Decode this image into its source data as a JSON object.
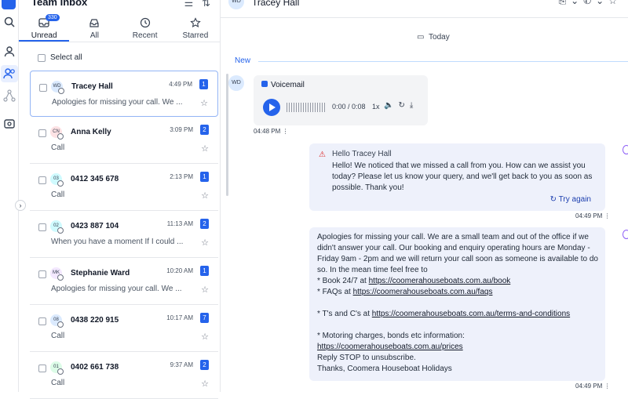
{
  "sidebar": {
    "logo": "app-logo",
    "icons": [
      "search-icon",
      "user-icon",
      "team-icon",
      "flow-icon",
      "settings-icon"
    ]
  },
  "inbox": {
    "title": "Team Inbox",
    "tabs": [
      {
        "label": "Unread",
        "badge": "330"
      },
      {
        "label": "All"
      },
      {
        "label": "Recent"
      },
      {
        "label": "Starred"
      }
    ],
    "select_all": "Select all",
    "items": [
      {
        "initials": "WD",
        "name": "Tracey Hall",
        "time": "4:49 PM",
        "count": "1",
        "preview": "Apologies for missing your call. We ...",
        "avatar_color": "#dbeafe"
      },
      {
        "initials": "CN",
        "name": "Anna Kelly",
        "time": "3:09 PM",
        "count": "2",
        "preview": "Call",
        "avatar_color": "#fde2e4"
      },
      {
        "initials": "03",
        "name": "0412 345 678",
        "time": "2:13 PM",
        "count": "1",
        "preview": "Call",
        "avatar_color": "#cffafe"
      },
      {
        "initials": "02",
        "name": "0423 887 104",
        "time": "11:13 AM",
        "count": "2",
        "preview": "When you have a moment If I could ...",
        "avatar_color": "#cffafe"
      },
      {
        "initials": "MK",
        "name": "Stephanie Ward",
        "time": "10:20 AM",
        "count": "1",
        "preview": "Apologies for missing your call. We ...",
        "avatar_color": "#f3e8ff"
      },
      {
        "initials": "08",
        "name": "0438 220 915",
        "time": "10:17 AM",
        "count": "7",
        "preview": "Call",
        "avatar_color": "#dbeafe"
      },
      {
        "initials": "01",
        "name": "0402 661 738",
        "time": "9:37 AM",
        "count": "2",
        "preview": "Call",
        "avatar_color": "#dcfce7"
      }
    ]
  },
  "conversation": {
    "contact_initials": "WD",
    "contact_name": "Tracey Hall",
    "date_label": "Today",
    "new_label": "New",
    "voicemail": {
      "label": "Voicemail",
      "time": "0:00 / 0:08",
      "speed": "1x",
      "sent": "04:48 PM"
    },
    "auto_reply": {
      "greeting": "Hello Tracey Hall",
      "body": "Hello! We noticed that we missed a call from you. How can we assist you today? Please let us know your query, and we'll get back to you as soon as possible. Thank you!",
      "retry": "Try again",
      "sent": "04:49 PM"
    },
    "sms": {
      "intro": "Apologies for missing your call. We are a small team and out of the office if we didn't answer your call. Our booking and enquiry operating hours are Monday - Friday 9am - 2pm and we will return your call soon as someone is available to do so. In the mean time feel free to",
      "book_prefix": "* Book 24/7 at ",
      "book_link": "https://coomerahouseboats.com.au/book",
      "faq_prefix": "* FAQs at ",
      "faq_link": "https://coomerahouseboats.com.au/faqs",
      "tc_prefix": "* T's and C's at ",
      "tc_link": "https://coomerahouseboats.com.au/terms-and-conditions",
      "motoring": "* Motoring charges, bonds etc information:",
      "prices_link": "https://coomerahouseboats.com.au/prices",
      "stop": "Reply STOP to unsubscribe.",
      "sign": "Thanks, Coomera Houseboat Holidays",
      "sent": "04:49 PM"
    }
  }
}
